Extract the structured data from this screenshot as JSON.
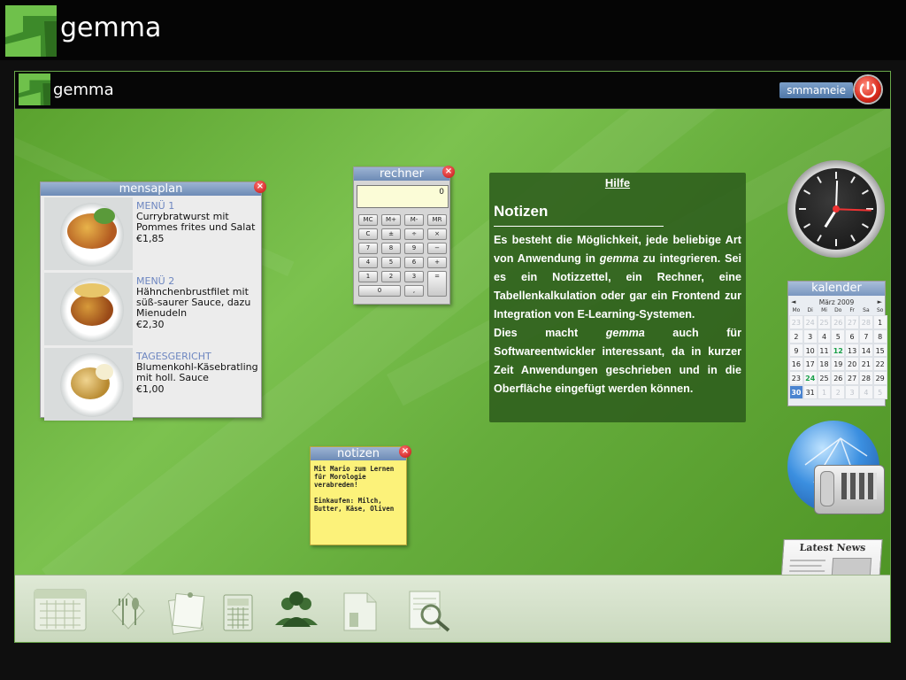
{
  "brand": {
    "name": "gemma",
    "inner_name": "gemma"
  },
  "user": {
    "name": "smmameie",
    "power_icon": "power-icon"
  },
  "colors": {
    "accent": "#6cb042",
    "title_bar": "#6d8bb6",
    "close": "#c01010",
    "note": "#fcf27a",
    "help_bg": "#2e5d1c"
  },
  "mensaplan": {
    "title": "mensaplan",
    "items": [
      {
        "category": "MENÜ 1",
        "description": "Currybratwurst mit Pommes frites und Salat",
        "price": "€1,85"
      },
      {
        "category": "MENÜ 2",
        "description": "Hähnchenbrustfilet mit süß-saurer Sauce, dazu Mienudeln",
        "price": "€2,30"
      },
      {
        "category": "TAGESGERICHT",
        "description": "Blumenkohl-Käsebratling mit holl. Sauce",
        "price": "€1,00"
      }
    ]
  },
  "rechner": {
    "title": "rechner",
    "display": "0",
    "keys": [
      "MC",
      "M+",
      "M-",
      "MR",
      "C",
      "±",
      "÷",
      "×",
      "7",
      "8",
      "9",
      "−",
      "4",
      "5",
      "6",
      "+",
      "1",
      "2",
      "3",
      "",
      "0",
      ",",
      "="
    ]
  },
  "notizen_widget": {
    "title": "notizen",
    "text": "Mit Mario zum Lernen für Morologie verabreden!\n\nEinkaufen: Milch, Butter, Käse, Oliven"
  },
  "hilfe": {
    "heading": "Hilfe",
    "title": "Notizen",
    "body_1": "Es besteht die Möglichkeit, jede beliebige Art von Anwendung in ",
    "body_em_1": "gemma",
    "body_2": " zu integrieren. Sei es ein Notizzettel, ein Rechner, eine Tabellenkalkulation oder gar ein Frontend zur Integration von E-Learning-Systemen.",
    "body_3": "Dies macht ",
    "body_em_2": "gemma",
    "body_4": " auch für Softwareentwickler interessant, da in kurzer Zeit Anwendungen geschrieben und in die Oberfläche eingefügt werden können."
  },
  "kalender": {
    "title": "kalender",
    "month": "März 2009",
    "prev": "◄",
    "next": "►",
    "dows": [
      "Mo",
      "Di",
      "Mi",
      "Do",
      "Fr",
      "Sa",
      "So"
    ],
    "weeks": [
      [
        "23",
        "24",
        "25",
        "26",
        "27",
        "28",
        "1"
      ],
      [
        "2",
        "3",
        "4",
        "5",
        "6",
        "7",
        "8"
      ],
      [
        "9",
        "10",
        "11",
        "12",
        "13",
        "14",
        "15"
      ],
      [
        "16",
        "17",
        "18",
        "19",
        "20",
        "21",
        "22"
      ],
      [
        "23",
        "24",
        "25",
        "26",
        "27",
        "28",
        "29"
      ],
      [
        "30",
        "31",
        "1",
        "2",
        "3",
        "4",
        "5"
      ]
    ]
  },
  "news": {
    "title": "Latest News"
  },
  "dock": {
    "icons": [
      "calendar-icon",
      "cutlery-icon",
      "notes-icon",
      "calculator-icon",
      "people-icon",
      "folder-icon",
      "search-icon"
    ]
  }
}
